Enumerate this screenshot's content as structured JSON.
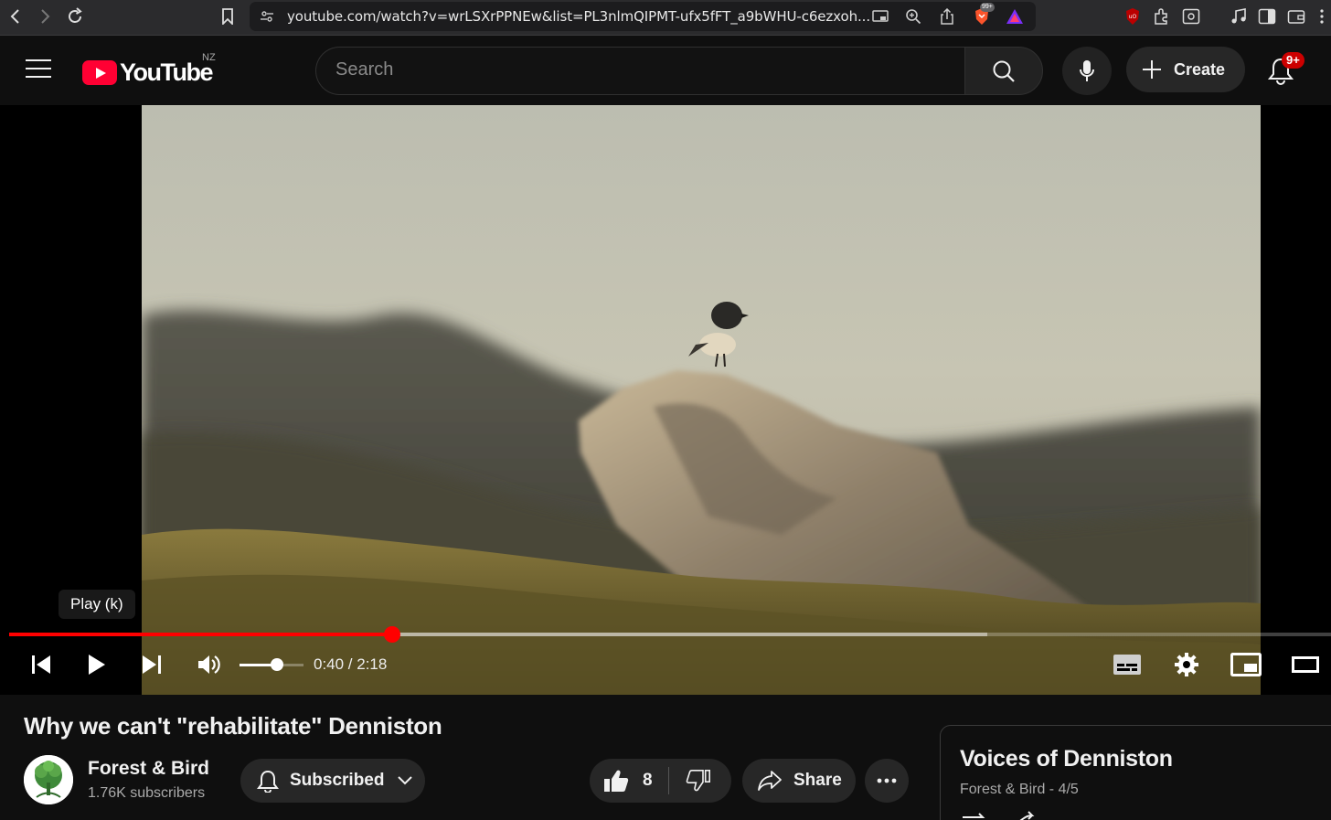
{
  "browser": {
    "url": "youtube.com/watch?v=wrLSXrPPNEw&list=PL3nlmQIPMT-ufx5fFT_a9bWHU-c6ezxoh...",
    "brave_badge": "99+"
  },
  "header": {
    "logo_text": "YouTube",
    "country_code": "NZ",
    "search_placeholder": "Search",
    "create_label": "Create",
    "notifications_badge": "9+"
  },
  "player": {
    "tooltip": "Play (k)",
    "current_time": "0:40",
    "duration": "2:18",
    "time_display": "0:40 / 2:18",
    "progress_fraction": 0.29,
    "buffered_fraction": 0.74,
    "volume_fraction": 0.58
  },
  "video": {
    "title": "Why we can't \"rehabilitate\" Denniston",
    "channel_name": "Forest & Bird",
    "subscribers": "1.76K subscribers",
    "subscribe_label": "Subscribed",
    "like_count": "8",
    "share_label": "Share"
  },
  "playlist": {
    "title": "Voices of Denniston",
    "owner_position": "Forest & Bird - 4/5"
  },
  "colors": {
    "brand_red": "#ff0033",
    "progress_red": "#ff0000",
    "background": "#0f0f0f"
  }
}
